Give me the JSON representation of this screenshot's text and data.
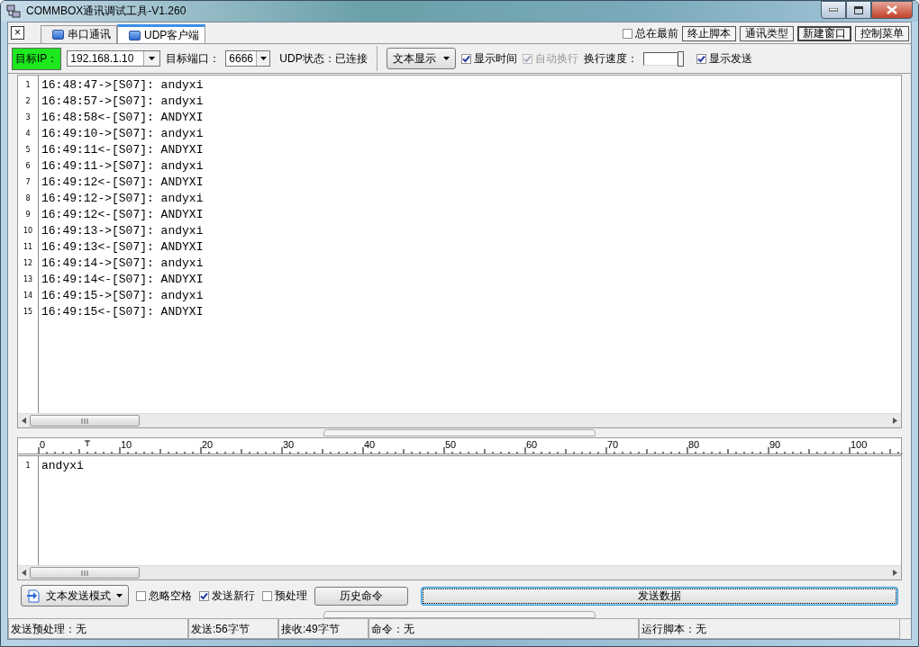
{
  "window": {
    "title": "COMMBOX通讯调试工具-V1.260"
  },
  "tab_close": "×",
  "tabs": [
    {
      "label": "串口通讯",
      "selected": false
    },
    {
      "label": "UDP客户端",
      "selected": true
    }
  ],
  "top_controls": {
    "always_on_top": {
      "label": "总在最前",
      "checked": false
    },
    "buttons": [
      {
        "label": "终止脚本",
        "default": false
      },
      {
        "label": "通讯类型",
        "default": false
      },
      {
        "label": "新建窗口",
        "default": true
      },
      {
        "label": "控制菜单",
        "default": false
      }
    ]
  },
  "toolbar": {
    "ip_label": "目标IP：",
    "ip": "192.168.1.10",
    "port_label": "目标端口：",
    "port": "6666",
    "status": "UDP状态：已连接",
    "display_mode": "文本显示",
    "options": [
      {
        "label": "显示时间",
        "checked": true,
        "disabled": false
      },
      {
        "label": "自动换行",
        "checked": true,
        "disabled": true
      }
    ],
    "speed_label": "换行速度：",
    "show_send": {
      "label": "显示发送",
      "checked": true,
      "disabled": false
    }
  },
  "log": [
    {
      "number": "1",
      "text": "16:48:47->[S07]: andyxi"
    },
    {
      "number": "2",
      "text": "16:48:57->[S07]: andyxi"
    },
    {
      "number": "3",
      "text": "16:48:58<-[S07]: ANDYXI"
    },
    {
      "number": "4",
      "text": "16:49:10->[S07]: andyxi"
    },
    {
      "number": "5",
      "text": "16:49:11<-[S07]: ANDYXI"
    },
    {
      "number": "6",
      "text": "16:49:11->[S07]: andyxi"
    },
    {
      "number": "7",
      "text": "16:49:12<-[S07]: ANDYXI"
    },
    {
      "number": "8",
      "text": "16:49:12->[S07]: andyxi"
    },
    {
      "number": "9",
      "text": "16:49:12<-[S07]: ANDYXI"
    },
    {
      "number": "10",
      "text": "16:49:13->[S07]: andyxi"
    },
    {
      "number": "11",
      "text": "16:49:13<-[S07]: ANDYXI"
    },
    {
      "number": "12",
      "text": "16:49:14->[S07]: andyxi"
    },
    {
      "number": "13",
      "text": "16:49:14<-[S07]: ANDYXI"
    },
    {
      "number": "14",
      "text": "16:49:15->[S07]: andyxi"
    },
    {
      "number": "15",
      "text": "16:49:15<-[S07]: ANDYXI"
    }
  ],
  "ruler": {
    "labels": [
      "0",
      "10",
      "20",
      "30",
      "40",
      "50",
      "60",
      "70",
      "80",
      "90",
      "100"
    ]
  },
  "send_editor": [
    {
      "number": "1",
      "text": "andyxi"
    }
  ],
  "send_controls": {
    "mode": "文本发送模式",
    "options": [
      {
        "label": "忽略空格",
        "checked": false,
        "disabled": false
      },
      {
        "label": "发送新行",
        "checked": true,
        "disabled": false
      },
      {
        "label": "预处理",
        "checked": false,
        "disabled": false
      }
    ],
    "history_button": "历史命令",
    "send_button": "发送数据"
  },
  "status_bar": [
    "发送预处理：无",
    "发送:56字节",
    "接收:49字节",
    "命令：无",
    "运行脚本：无"
  ]
}
